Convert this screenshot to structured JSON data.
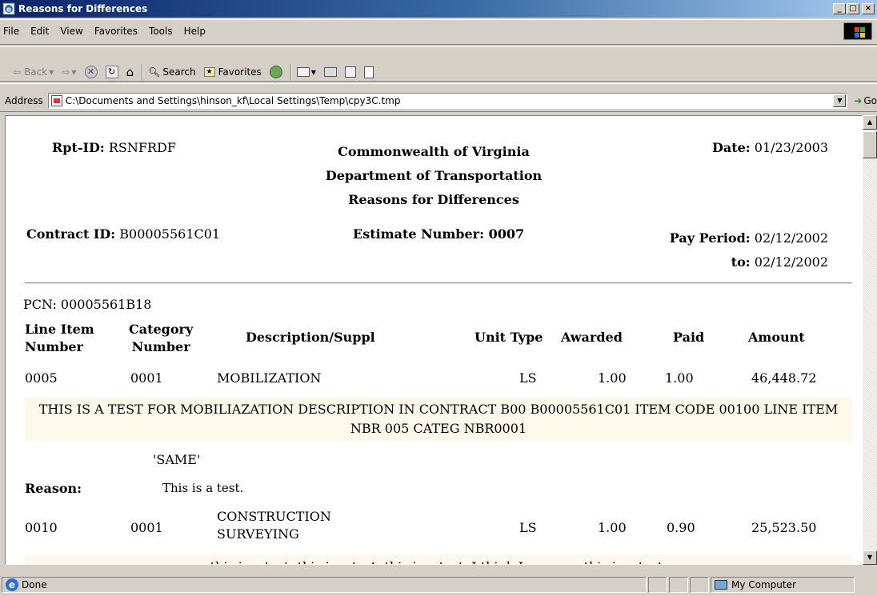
{
  "window": {
    "title": "Reasons for Differences",
    "minimize": "_",
    "maximize": "□",
    "close": "×"
  },
  "menu": {
    "file": "File",
    "edit": "Edit",
    "view": "View",
    "favorites": "Favorites",
    "tools": "Tools",
    "help": "Help"
  },
  "toolbar": {
    "back": "Back",
    "search": "Search",
    "favorites": "Favorites"
  },
  "address": {
    "label": "Address",
    "url": "C:\\Documents and Settings\\hinson_kf\\Local Settings\\Temp\\cpy3C.tmp",
    "go": "Go"
  },
  "report": {
    "rpt_id_label": "Rpt-ID:",
    "rpt_id": "RSNFRDF",
    "org1": "Commonwealth of Virginia",
    "org2": "Department of Transportation",
    "org3": "Reasons for Differences",
    "date_label": "Date:",
    "date": "01/23/2003",
    "contract_label": "Contract ID:",
    "contract": "B00005561C01",
    "estimate_label": "Estimate Number:",
    "estimate": "0007",
    "pay_period_label": "Pay Period:",
    "pay_period_from": "02/12/2002",
    "to_label": "to:",
    "pay_period_to": "02/12/2002",
    "pcn": "PCN: 00005561B18"
  },
  "columns": {
    "line_item_1": "Line Item",
    "line_item_2": "Number",
    "category_1": "Category",
    "category_2": "Number",
    "description": "Description/Suppl",
    "unit_type": "Unit Type",
    "awarded": "Awarded",
    "paid": "Paid",
    "amount": "Amount"
  },
  "rows": [
    {
      "line": "0005",
      "category": "0001",
      "description": "MOBILIZATION",
      "unit": "LS",
      "awarded": "1.00",
      "paid": "1.00",
      "amount": "46,448.72",
      "note": "THIS IS A TEST FOR MOBILIAZATION DESCRIPTION IN CONTRACT B00 B00005561C01 ITEM CODE 00100 LINE ITEM NBR 005 CATEG NBR0001",
      "suppl": "'SAME'",
      "reason_label": "Reason:",
      "reason": "This is a test."
    },
    {
      "line": "0010",
      "category": "0001",
      "description_1": "CONSTRUCTION",
      "description_2": "SURVEYING",
      "unit": "LS",
      "awarded": "1.00",
      "paid": "0.90",
      "amount": "25,523.50",
      "note": "this is a test. this is a test. this is a test. I think I am sure this is a test."
    }
  ],
  "status": {
    "text": "Done",
    "zone": "My Computer"
  }
}
